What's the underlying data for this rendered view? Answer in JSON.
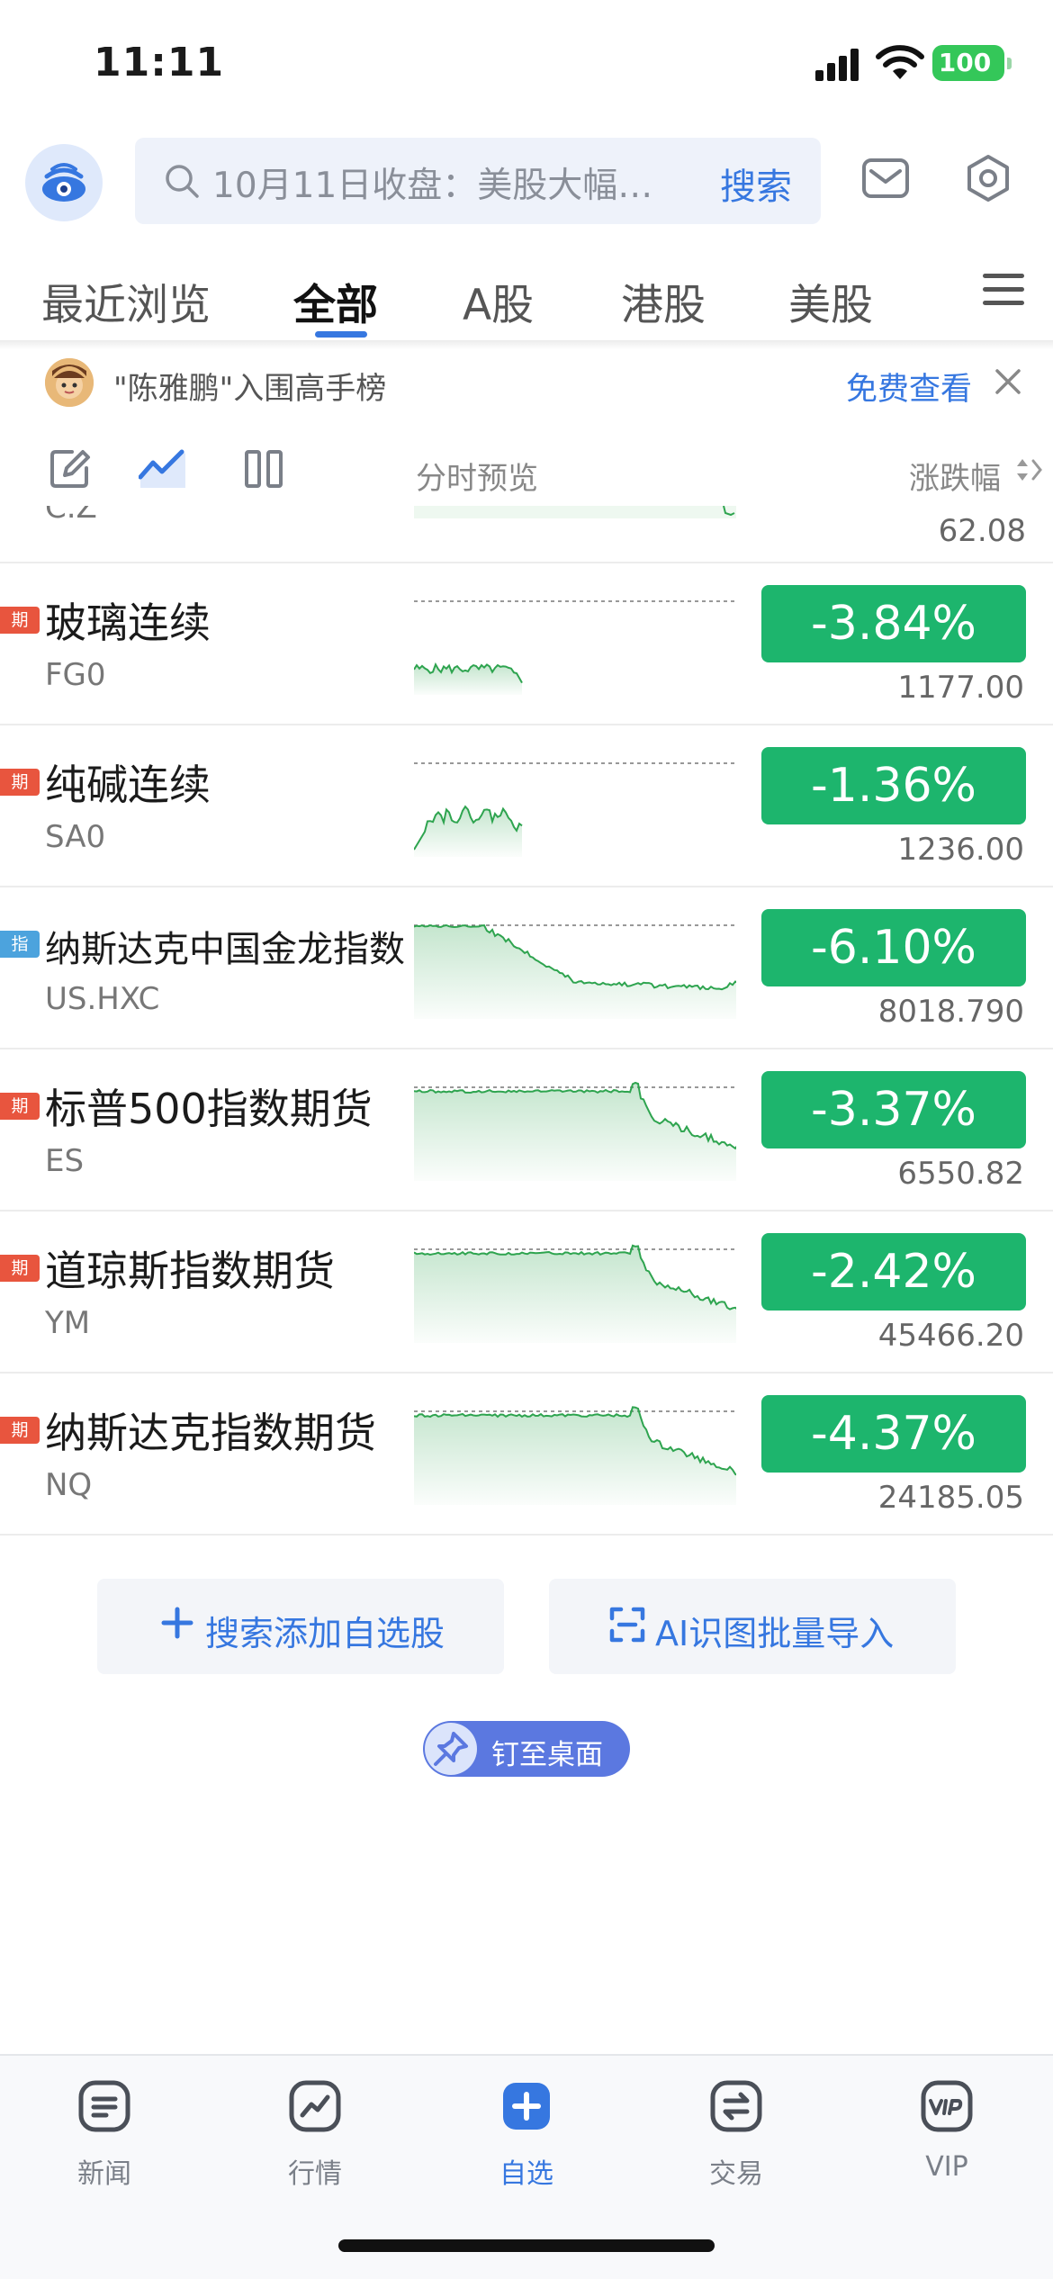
{
  "status_bar": {
    "time": "11:11",
    "battery": "100"
  },
  "header": {
    "search_placeholder": "10月11日收盘：美股大幅…",
    "search_button": "搜索"
  },
  "tabs": [
    "最近浏览",
    "全部",
    "A股",
    "港股",
    "美股"
  ],
  "promo": {
    "text": "\"陈雅鹏\"入围高手榜",
    "link": "免费查看"
  },
  "toolbar": {
    "preview_label": "分时预览",
    "change_label": "涨跌幅"
  },
  "partial_row": {
    "code": "C.Z",
    "price": "62.08"
  },
  "rows": [
    {
      "tag": "期",
      "tag_color": "#e8553e",
      "name": "玻璃连续",
      "code": "FG0",
      "change": "-3.84%",
      "price": "1177.00",
      "spark": "short_flat"
    },
    {
      "tag": "期",
      "tag_color": "#e8553e",
      "name": "纯碱连续",
      "code": "SA0",
      "change": "-1.36%",
      "price": "1236.00",
      "spark": "short_rise"
    },
    {
      "tag": "指",
      "tag_color": "#4ca3dd",
      "name": "纳斯达克中国金龙指数",
      "code": "US.HXC",
      "change": "-6.10%",
      "price": "8018.790",
      "spark": "early_drop"
    },
    {
      "tag": "期",
      "tag_color": "#e8553e",
      "name": "标普500指数期货",
      "code": "ES",
      "change": "-3.37%",
      "price": "6550.82",
      "spark": "late_drop"
    },
    {
      "tag": "期",
      "tag_color": "#e8553e",
      "name": "道琼斯指数期货",
      "code": "YM",
      "change": "-2.42%",
      "price": "45466.20",
      "spark": "late_drop"
    },
    {
      "tag": "期",
      "tag_color": "#e8553e",
      "name": "纳斯达克指数期货",
      "code": "NQ",
      "change": "-4.37%",
      "price": "24185.05",
      "spark": "late_drop"
    }
  ],
  "actions": {
    "add": "搜索添加自选股",
    "ai_import": "AI识图批量导入",
    "pin": "钉至桌面"
  },
  "bottom_nav": [
    {
      "label": "新闻",
      "icon": "news-icon"
    },
    {
      "label": "行情",
      "icon": "market-icon"
    },
    {
      "label": "自选",
      "icon": "watchlist-icon"
    },
    {
      "label": "交易",
      "icon": "trade-icon"
    },
    {
      "label": "VIP",
      "icon": "vip-icon"
    }
  ],
  "colors": {
    "accent": "#3677e0",
    "down": "#1db56d",
    "futures_tag": "#e8553e",
    "index_tag": "#4ca3dd"
  }
}
